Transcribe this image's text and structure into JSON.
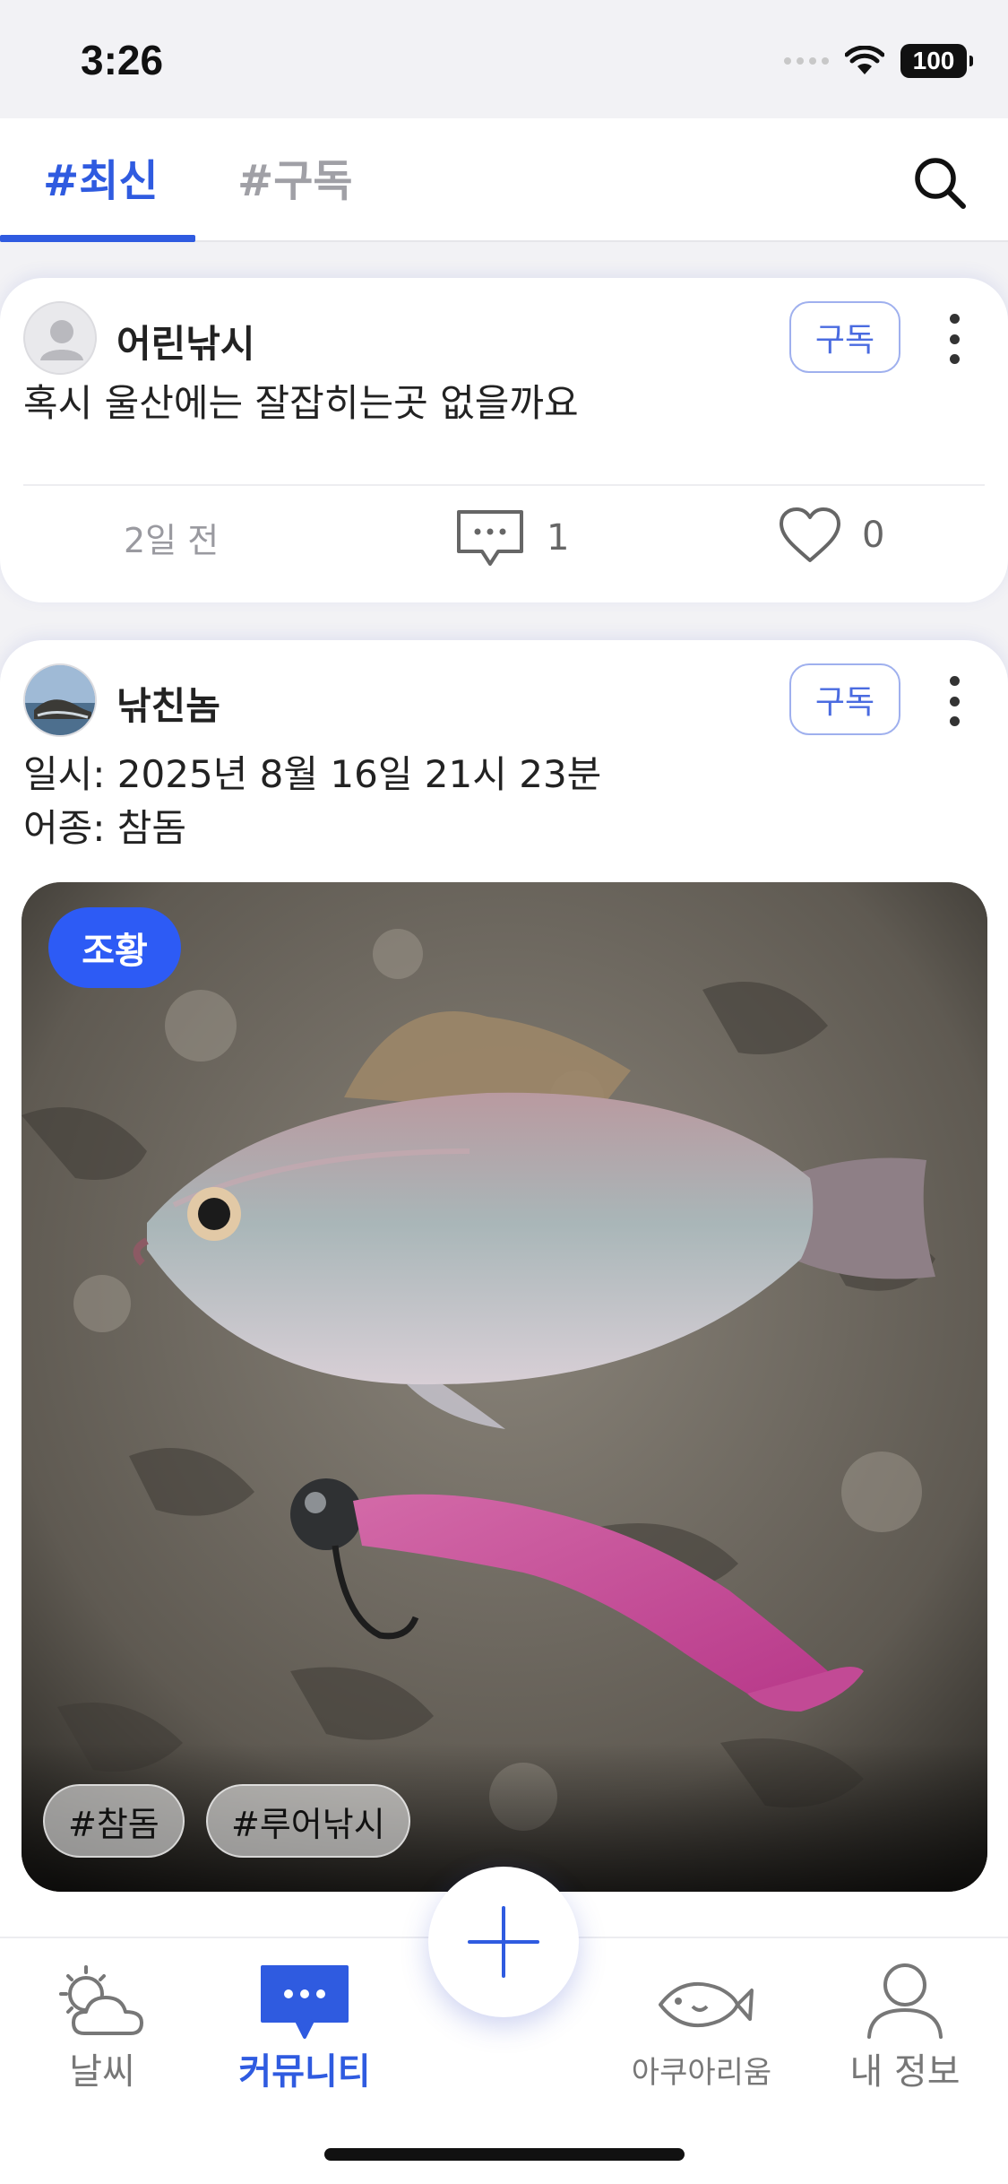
{
  "status_bar": {
    "time": "3:26",
    "battery": "100"
  },
  "tabs": [
    {
      "label": "#최신",
      "active": true
    },
    {
      "label": "#구독",
      "active": false
    }
  ],
  "posts": [
    {
      "username": "어린낚시",
      "subscribe_label": "구독",
      "text": "혹시 울산에는 잘잡히는곳 없을까요",
      "time": "2일 전",
      "comments": "1",
      "likes": "0"
    },
    {
      "username": "낚친놈",
      "subscribe_label": "구독",
      "line1": "일시: 2025년 8월 16일 21시 23분",
      "line2": "어종: 참돔",
      "badge": "조황",
      "tags": [
        "#참돔",
        "#루어낚시"
      ]
    }
  ],
  "bottom_nav": [
    {
      "label": "날씨",
      "icon": "weather-icon",
      "active": false
    },
    {
      "label": "커뮤니티",
      "icon": "chat-bubble-icon",
      "active": true
    },
    {
      "label": "아쿠아리움",
      "icon": "fish-icon",
      "active": false
    },
    {
      "label": "내 정보",
      "icon": "person-icon",
      "active": false
    }
  ],
  "colors": {
    "accent": "#2f5be0",
    "badge": "#2d5bf5"
  }
}
